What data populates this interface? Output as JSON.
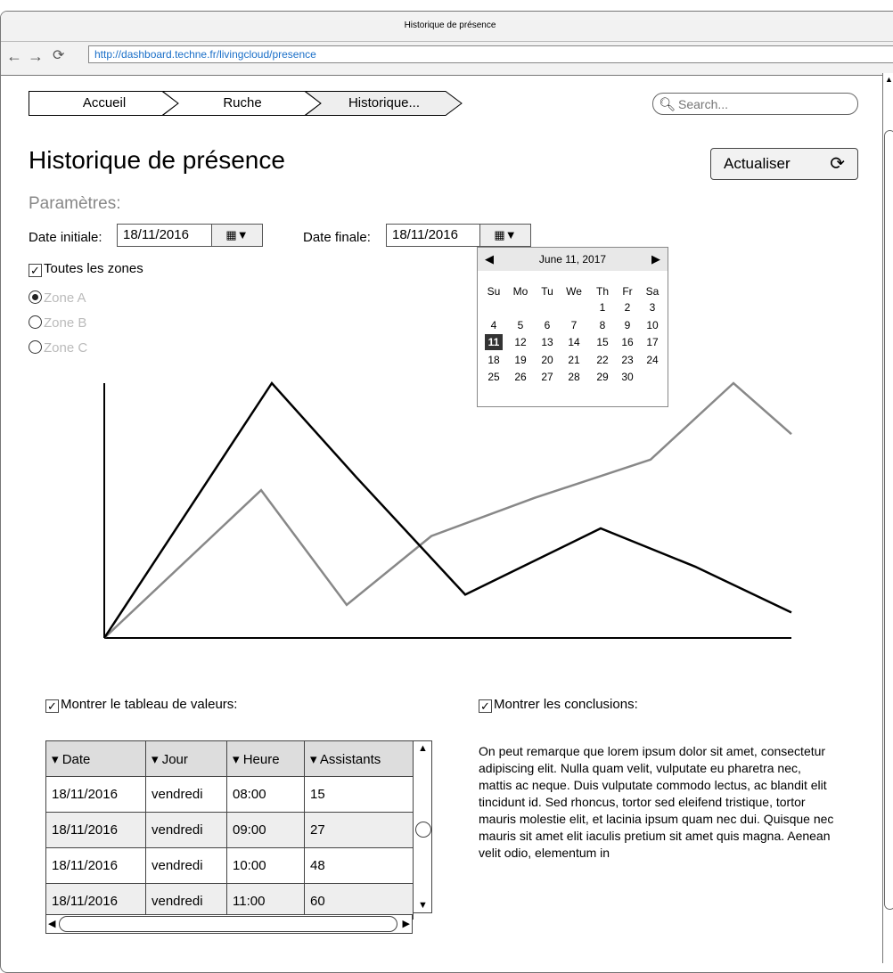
{
  "window": {
    "title": "Historique de présence",
    "url": "http://dashboard.techne.fr/livingcloud/presence"
  },
  "breadcrumbs": [
    "Accueil",
    "Ruche",
    "Historique..."
  ],
  "search": {
    "placeholder": "Search..."
  },
  "page": {
    "title": "Historique de présence",
    "refresh_label": "Actualiser",
    "params_label": "Paramètres:"
  },
  "dates": {
    "start_label": "Date initiale:",
    "start_value": "18/11/2016",
    "end_label": "Date finale:",
    "end_value": "18/11/2016"
  },
  "zones": {
    "all_label": "Toutes les zones",
    "items": [
      {
        "label": "Zone A",
        "selected": true
      },
      {
        "label": "Zone B",
        "selected": false
      },
      {
        "label": "Zone C",
        "selected": false
      }
    ]
  },
  "calendar": {
    "month_label": "June 11, 2017",
    "weekdays": [
      "Su",
      "Mo",
      "Tu",
      "We",
      "Th",
      "Fr",
      "Sa"
    ],
    "weeks": [
      [
        "",
        "",
        "",
        "",
        "1",
        "2",
        "3"
      ],
      [
        "4",
        "5",
        "6",
        "7",
        "8",
        "9",
        "10"
      ],
      [
        "11",
        "12",
        "13",
        "14",
        "15",
        "16",
        "17"
      ],
      [
        "18",
        "19",
        "20",
        "21",
        "22",
        "23",
        "24"
      ],
      [
        "25",
        "26",
        "27",
        "28",
        "29",
        "30",
        ""
      ]
    ],
    "selected": "11"
  },
  "chart_data": {
    "type": "line",
    "x": [
      0,
      1,
      2,
      3,
      4,
      5,
      6,
      7,
      8
    ],
    "series": [
      {
        "values": [
          0,
          100,
          63,
          17,
          43,
          28,
          10,
          0,
          0
        ],
        "color": "#000000"
      },
      {
        "values": [
          0,
          58,
          13,
          40,
          55,
          70,
          100,
          80,
          80
        ],
        "color": "#888888"
      }
    ],
    "grid": false
  },
  "table": {
    "show_label": "Montrer le tableau de valeurs:",
    "columns": [
      "Date",
      "Jour",
      "Heure",
      "Assistants"
    ],
    "rows": [
      [
        "18/11/2016",
        "vendredi",
        "08:00",
        "15"
      ],
      [
        "18/11/2016",
        "vendredi",
        "09:00",
        "27"
      ],
      [
        "18/11/2016",
        "vendredi",
        "10:00",
        "48"
      ],
      [
        "18/11/2016",
        "vendredi",
        "11:00",
        "60"
      ]
    ]
  },
  "conclusions": {
    "show_label": "Montrer les conclusions:",
    "text": "On peut remarque que lorem ipsum dolor sit amet, consectetur adipiscing elit. Nulla quam velit, vulputate eu pharetra nec, mattis ac neque. Duis vulputate commodo lectus, ac blandit elit tincidunt id. Sed rhoncus, tortor sed eleifend tristique, tortor mauris molestie elit, et lacinia ipsum quam nec dui. Quisque nec mauris sit amet elit iaculis pretium sit amet quis magna. Aenean velit odio, elementum in"
  }
}
